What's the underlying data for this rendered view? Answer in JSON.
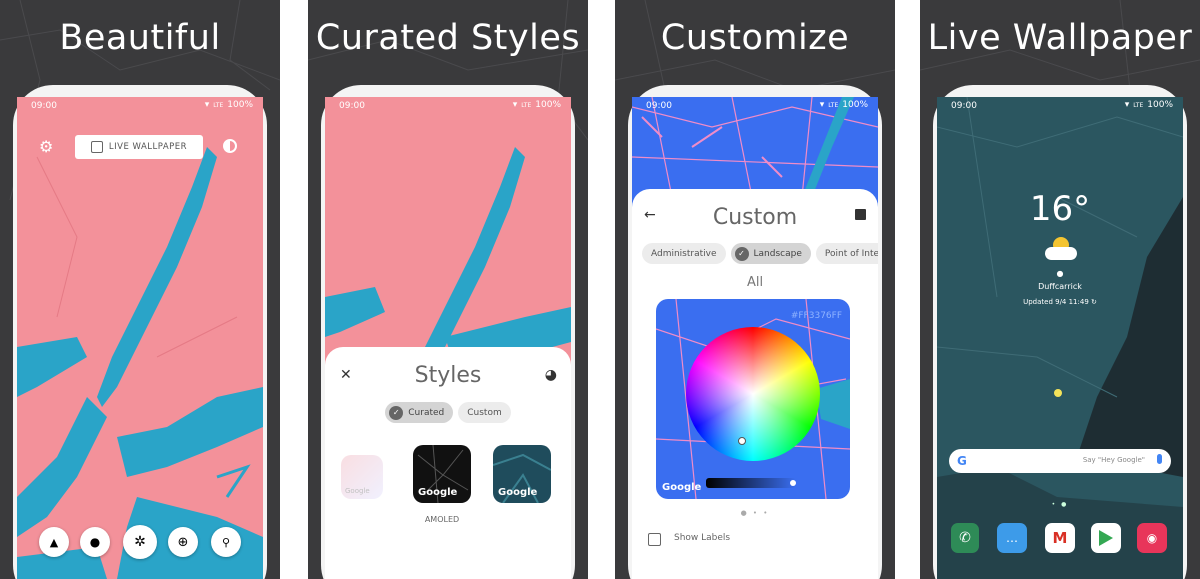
{
  "panels": [
    {
      "headline": "Beautiful"
    },
    {
      "headline": "Curated Styles"
    },
    {
      "headline": "Customize"
    },
    {
      "headline": "Live Wallpaper"
    }
  ],
  "status": {
    "time": "09:00",
    "network": "LTE",
    "battery": "100%"
  },
  "screen1": {
    "live_wallpaper_label": "LIVE WALLPAPER"
  },
  "styles": {
    "title": "Styles",
    "chips": [
      "Curated",
      "Custom"
    ],
    "thumb_label": "Google",
    "caption": "AMOLED"
  },
  "custom": {
    "title": "Custom",
    "chips": [
      "Administrative",
      "Landscape",
      "Point of Intere"
    ],
    "section": "All",
    "hex_value": "#FF3376FF",
    "map_label": "Google",
    "show_labels": "Show Labels"
  },
  "home": {
    "temperature": "16°",
    "location": "Duffcarrick",
    "updated": "Updated 9/4 11:49",
    "search_hint": "Say \"Hey Google\"",
    "google_g": "G"
  },
  "colors": {
    "map_pink": "#f3919a",
    "map_water": "#2aa4c8",
    "custom_land": "#3a6ef0",
    "custom_roads": "#f08cc8",
    "home_bg": "#2b5660",
    "panel_bg": "#3a3a3c"
  },
  "icons": [
    "settings-icon",
    "wallpaper-icon",
    "theme-icon",
    "mountain-icon",
    "pin-icon",
    "aperture-icon",
    "location-target-icon",
    "search-icon",
    "close-icon",
    "palette-icon",
    "back-arrow-icon",
    "save-icon",
    "checkbox-icon",
    "phone-icon",
    "messages-icon",
    "gmail-icon",
    "play-store-icon",
    "camera-icon",
    "mic-icon",
    "weather-icon"
  ]
}
